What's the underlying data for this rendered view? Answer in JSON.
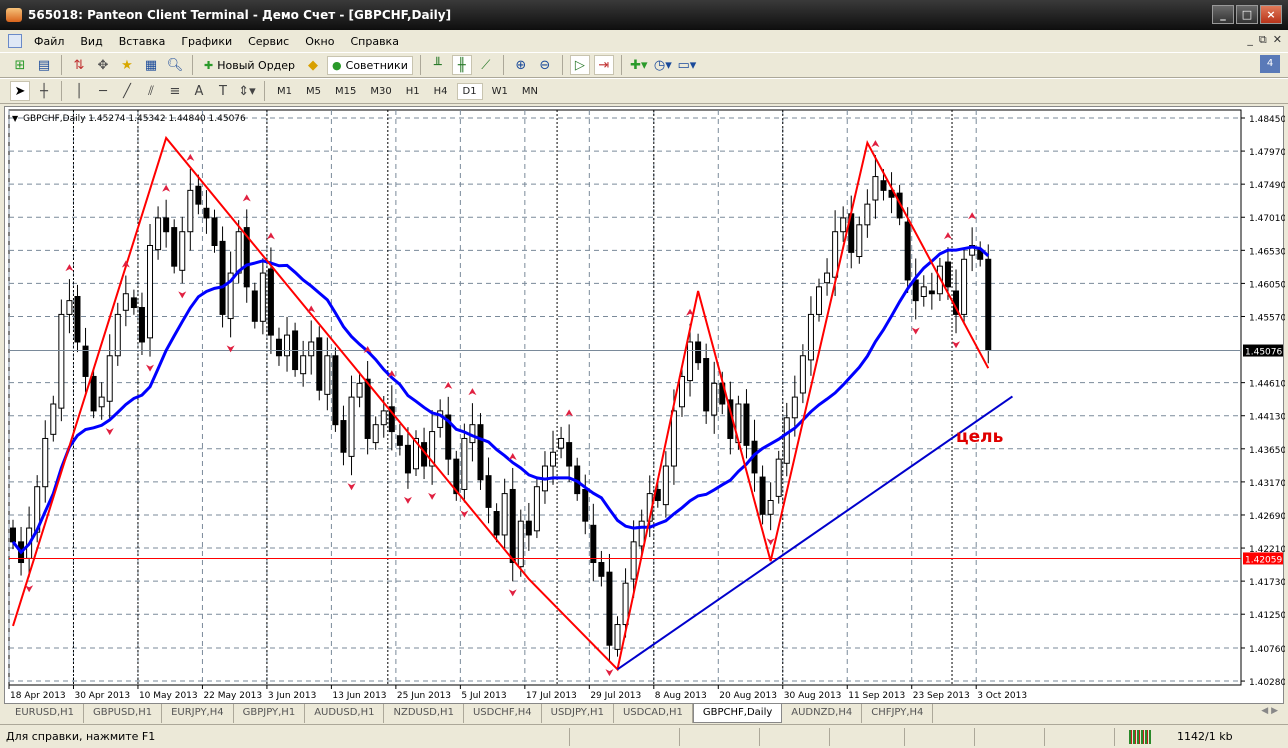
{
  "window": {
    "title": "565018: Panteon Client Terminal - Демо Счет - [GBPCHF,Daily]",
    "buttons": [
      "_",
      "□",
      "×"
    ]
  },
  "menu": [
    "Файл",
    "Вид",
    "Вставка",
    "Графики",
    "Сервис",
    "Окно",
    "Справка"
  ],
  "toolbar": {
    "new_order": "Новый Ордер",
    "experts": "Советники"
  },
  "timeframes": [
    "M1",
    "M5",
    "M15",
    "M30",
    "H1",
    "H4",
    "D1",
    "W1",
    "MN"
  ],
  "active_timeframe": "D1",
  "tabs": [
    "EURUSD,H1",
    "GBPUSD,H1",
    "EURJPY,H4",
    "GBPJPY,H1",
    "AUDUSD,H1",
    "NZDUSD,H1",
    "USDCHF,H4",
    "USDJPY,H1",
    "USDCAD,H1",
    "GBPCHF,Daily",
    "AUDNZD,H4",
    "CHFJPY,H4"
  ],
  "active_tab": "GBPCHF,Daily",
  "status": {
    "help": "Для справки, нажмите F1",
    "traffic": "1142/1 kb"
  },
  "chart_data": {
    "type": "candlestick",
    "symbol_header": "GBPCHF,Daily  1.45274 1.45342 1.44840 1.45076",
    "price_ticks": [
      "1.48450",
      "1.47970",
      "1.47490",
      "1.47010",
      "1.46530",
      "1.46050",
      "1.45570",
      "1.44610",
      "1.44130",
      "1.43650",
      "1.43170",
      "1.42690",
      "1.42210",
      "1.41730",
      "1.41250",
      "1.40760",
      "1.40280"
    ],
    "ylim": [
      1.4028,
      1.4845
    ],
    "date_labels": [
      "18 Apr 2013",
      "30 Apr 2013",
      "10 May 2013",
      "22 May 2013",
      "3 Jun 2013",
      "13 Jun 2013",
      "25 Jun 2013",
      "5 Jul 2013",
      "17 Jul 2013",
      "29 Jul 2013",
      "8 Aug 2013",
      "20 Aug 2013",
      "30 Aug 2013",
      "11 Sep 2013",
      "23 Sep 2013",
      "3 Oct 2013"
    ],
    "closes": [
      1.423,
      1.42,
      1.425,
      1.431,
      1.438,
      1.443,
      1.456,
      1.458,
      1.452,
      1.447,
      1.442,
      1.444,
      1.45,
      1.456,
      1.459,
      1.457,
      1.452,
      1.466,
      1.47,
      1.468,
      1.463,
      1.468,
      1.474,
      1.472,
      1.47,
      1.466,
      1.456,
      1.462,
      1.468,
      1.46,
      1.455,
      1.462,
      1.453,
      1.45,
      1.453,
      1.448,
      1.45,
      1.452,
      1.445,
      1.45,
      1.44,
      1.436,
      1.444,
      1.446,
      1.438,
      1.44,
      1.442,
      1.439,
      1.437,
      1.433,
      1.438,
      1.434,
      1.439,
      1.442,
      1.435,
      1.43,
      1.438,
      1.44,
      1.432,
      1.428,
      1.424,
      1.43,
      1.42,
      1.426,
      1.424,
      1.431,
      1.434,
      1.436,
      1.438,
      1.434,
      1.43,
      1.426,
      1.42,
      1.418,
      1.408,
      1.411,
      1.417,
      1.423,
      1.426,
      1.43,
      1.429,
      1.434,
      1.442,
      1.447,
      1.452,
      1.449,
      1.442,
      1.446,
      1.443,
      1.438,
      1.443,
      1.437,
      1.433,
      1.427,
      1.429,
      1.435,
      1.441,
      1.444,
      1.45,
      1.456,
      1.46,
      1.462,
      1.468,
      1.47,
      1.465,
      1.469,
      1.472,
      1.476,
      1.474,
      1.473,
      1.47,
      1.461,
      1.458,
      1.46,
      1.459,
      1.463,
      1.46,
      1.456,
      1.464,
      1.466,
      1.464,
      1.4508
    ],
    "ma_period": 18,
    "zigzag": [
      [
        0,
        1.4108
      ],
      [
        19,
        1.4816
      ],
      [
        64,
        1.4176
      ],
      [
        75,
        1.4045
      ],
      [
        85,
        1.4594
      ],
      [
        94,
        1.4202
      ],
      [
        106,
        1.4809
      ],
      [
        121,
        1.4482
      ]
    ],
    "trendline": [
      [
        75,
        1.4045
      ],
      [
        124,
        1.4441
      ]
    ],
    "horizontal_line": {
      "price": "1.42059",
      "value": 1.42059
    },
    "current_price": {
      "price": "1.45076",
      "value": 1.45076
    },
    "annotation": {
      "text": "цель",
      "bar": 117,
      "price": 1.4375
    },
    "colors": {
      "zigzag": "#ff0000",
      "ma": "#0000ff",
      "trendline": "#0000cc",
      "fractals": "#e02040"
    }
  }
}
